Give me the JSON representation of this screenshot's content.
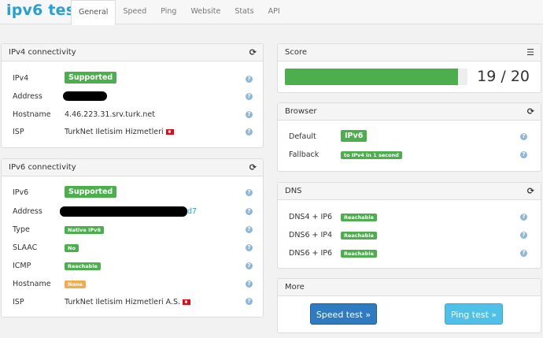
{
  "brand": {
    "prefix": "ipv",
    "six": "6",
    "suffix": " test"
  },
  "tabs": [
    "General",
    "Speed",
    "Ping",
    "Website",
    "Stats",
    "API"
  ],
  "ipv4": {
    "title": "IPv4 connectivity",
    "rows": [
      {
        "label": "IPv4",
        "badge": "Supported"
      },
      {
        "label": "Address"
      },
      {
        "label": "Hostname",
        "value": "4.46.223.31.srv.turk.net"
      },
      {
        "label": "ISP",
        "value": "TurkNet Iletisim Hizmetleri"
      }
    ]
  },
  "ipv6": {
    "title": "IPv6 connectivity",
    "rows": [
      {
        "label": "IPv6",
        "badge": "Supported"
      },
      {
        "label": "Address",
        "tail": "d7"
      },
      {
        "label": "Type",
        "badge": "Native IPv6"
      },
      {
        "label": "SLAAC",
        "badge": "No"
      },
      {
        "label": "ICMP",
        "badge": "Reachable"
      },
      {
        "label": "Hostname",
        "badge": "None"
      },
      {
        "label": "ISP",
        "value": "TurkNet Iletisim Hizmetleri A.S."
      }
    ]
  },
  "score": {
    "title": "Score",
    "value": 19,
    "max": 20,
    "text": "19 / 20",
    "fill_fraction": 0.95
  },
  "browser": {
    "title": "Browser",
    "rows": [
      {
        "label": "Default",
        "badge": "IPv6"
      },
      {
        "label": "Fallback",
        "badge": "to IPv4 in 1 second"
      }
    ]
  },
  "dns": {
    "title": "DNS",
    "rows": [
      {
        "label": "DNS4 + IP6",
        "badge": "Reachable"
      },
      {
        "label": "DNS6 + IP4",
        "badge": "Reachable"
      },
      {
        "label": "DNS6 + IP6",
        "badge": "Reachable"
      }
    ]
  },
  "more": {
    "title": "More",
    "speed_button": "Speed test »",
    "ping_button": "Ping test »"
  },
  "colors": {
    "accent": "#2a9fd6",
    "success": "#4cae4c",
    "warning": "#f0ad4e",
    "primary_button": "#2f7bc1",
    "info_button": "#4fc1e9"
  },
  "icons": {
    "refresh": "refresh-icon",
    "list": "list-icon",
    "help": "question-icon",
    "flag": "turkey-flag-icon"
  }
}
